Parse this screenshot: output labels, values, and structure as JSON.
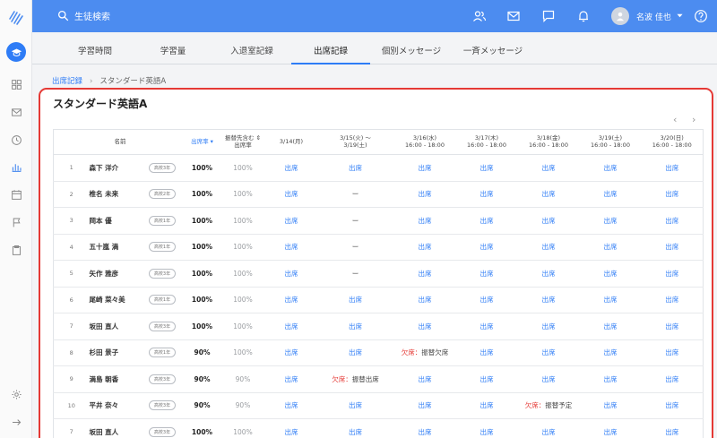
{
  "header": {
    "search_label": "生徒検索",
    "user_name": "名波 佳也"
  },
  "tabs": [
    {
      "label": "学習時間"
    },
    {
      "label": "学習量"
    },
    {
      "label": "入退室記録"
    },
    {
      "label": "出席記録"
    },
    {
      "label": "個別メッセージ"
    },
    {
      "label": "一斉メッセージ"
    }
  ],
  "breadcrumb": {
    "root": "出席記録",
    "current": "スタンダード英語A"
  },
  "card": {
    "title": "スタンダード英語A",
    "prev": "‹",
    "next": "›"
  },
  "table": {
    "col_name": "名前",
    "col_rate": "出席率",
    "col_rate2_line1": "振替先含む",
    "col_rate2_line2": "出席率",
    "days": [
      {
        "l1": "3/14(月)",
        "l2": ""
      },
      {
        "l1": "3/15(火) 〜",
        "l2": "3/19(土)"
      },
      {
        "l1": "3/16(水)",
        "l2": "16:00 - 18:00"
      },
      {
        "l1": "3/17(木)",
        "l2": "16:00 - 18:00"
      },
      {
        "l1": "3/18(金)",
        "l2": "16:00 - 18:00"
      },
      {
        "l1": "3/19(土)",
        "l2": "16:00 - 18:00"
      },
      {
        "l1": "3/20(日)",
        "l2": "16:00 - 18:00"
      }
    ],
    "rows": [
      {
        "no": "1",
        "name": "森下 洋介",
        "grade": "高校3年",
        "rate": "100%",
        "rate2": "100%",
        "cells": [
          "出席",
          "出席",
          "出席",
          "出席",
          "出席",
          "出席",
          "出席"
        ]
      },
      {
        "no": "2",
        "name": "椎名 未来",
        "grade": "高校2年",
        "rate": "100%",
        "rate2": "100%",
        "cells": [
          "出席",
          "ー",
          "出席",
          "出席",
          "出席",
          "出席",
          "出席"
        ]
      },
      {
        "no": "3",
        "name": "岡本 優",
        "grade": "高校1年",
        "rate": "100%",
        "rate2": "100%",
        "cells": [
          "出席",
          "ー",
          "出席",
          "出席",
          "出席",
          "出席",
          "出席"
        ]
      },
      {
        "no": "4",
        "name": "五十嵐 満",
        "grade": "高校1年",
        "rate": "100%",
        "rate2": "100%",
        "cells": [
          "出席",
          "ー",
          "出席",
          "出席",
          "出席",
          "出席",
          "出席"
        ]
      },
      {
        "no": "5",
        "name": "矢作 雅彦",
        "grade": "高校3年",
        "rate": "100%",
        "rate2": "100%",
        "cells": [
          "出席",
          "ー",
          "出席",
          "出席",
          "出席",
          "出席",
          "出席"
        ]
      },
      {
        "no": "6",
        "name": "尾崎 菜々美",
        "grade": "高校1年",
        "rate": "100%",
        "rate2": "100%",
        "cells": [
          "出席",
          "出席",
          "出席",
          "出席",
          "出席",
          "出席",
          "出席"
        ]
      },
      {
        "no": "7",
        "name": "坂田 直人",
        "grade": "高校3年",
        "rate": "100%",
        "rate2": "100%",
        "cells": [
          "出席",
          "出席",
          "出席",
          "出席",
          "出席",
          "出席",
          "出席"
        ]
      },
      {
        "no": "8",
        "name": "杉田 景子",
        "grade": "高校1年",
        "rate": "90%",
        "rate2": "100%",
        "cells": [
          "出席",
          "出席",
          "欠席：振替欠席",
          "出席",
          "出席",
          "出席",
          "出席"
        ]
      },
      {
        "no": "9",
        "name": "満島 朝香",
        "grade": "高校3年",
        "rate": "90%",
        "rate2": "90%",
        "cells": [
          "出席",
          "欠席：振替出席",
          "出席",
          "出席",
          "出席",
          "出席",
          "出席"
        ]
      },
      {
        "no": "10",
        "name": "平井 奈々",
        "grade": "高校3年",
        "rate": "90%",
        "rate2": "90%",
        "cells": [
          "出席",
          "出席",
          "出席",
          "出席",
          "欠席：振替予定",
          "出席",
          "出席"
        ]
      },
      {
        "no": "7",
        "name": "坂田 直人",
        "grade": "高校3年",
        "rate": "100%",
        "rate2": "100%",
        "cells": [
          "出席",
          "出席",
          "出席",
          "出席",
          "出席",
          "出席",
          "出席"
        ]
      }
    ]
  },
  "colors": {
    "accent": "#2e7cf6",
    "header": "#4c8cf0",
    "absent": "#e53935",
    "highlight_border": "#e53935"
  }
}
